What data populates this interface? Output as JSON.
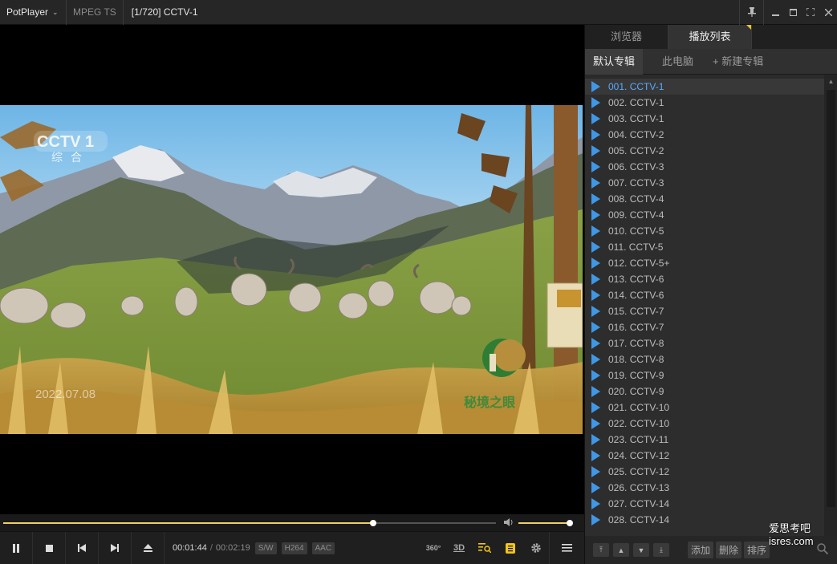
{
  "titlebar": {
    "app_name": "PotPlayer",
    "format": "MPEG TS",
    "title": "[1/720] CCTV-1"
  },
  "video": {
    "channel_logo": "CCTV 1",
    "channel_sub": "综合",
    "timestamp": "2022.07.08",
    "program_logo": "秘境之眼"
  },
  "playback": {
    "progress": 0.75,
    "volume": 0.97,
    "current_time": "00:01:44",
    "separator": "/",
    "duration": "00:02:19",
    "badges": [
      "S/W",
      "H264",
      "AAC"
    ],
    "icon_360": "360°",
    "icon_3d": "3D"
  },
  "panel": {
    "tabs": [
      "浏览器",
      "播放列表"
    ],
    "subtabs": [
      "默认专辑",
      "此电脑",
      "+ 新建专辑"
    ],
    "items": [
      "001. CCTV-1",
      "002. CCTV-1",
      "003. CCTV-1",
      "004. CCTV-2",
      "005. CCTV-2",
      "006. CCTV-3",
      "007. CCTV-3",
      "008. CCTV-4",
      "009. CCTV-4",
      "010. CCTV-5",
      "011. CCTV-5",
      "012. CCTV-5+",
      "013. CCTV-6",
      "014. CCTV-6",
      "015. CCTV-7",
      "016. CCTV-7",
      "017. CCTV-8",
      "018. CCTV-8",
      "019. CCTV-9",
      "020. CCTV-9",
      "021. CCTV-10",
      "022. CCTV-10",
      "023. CCTV-11",
      "024. CCTV-12",
      "025. CCTV-12",
      "026. CCTV-13",
      "027. CCTV-14",
      "028. CCTV-14"
    ],
    "selected_index": 0,
    "actions": [
      "添加",
      "删除",
      "排序"
    ]
  },
  "watermark": {
    "line1": "爱思考吧",
    "line2": "isres.com"
  }
}
